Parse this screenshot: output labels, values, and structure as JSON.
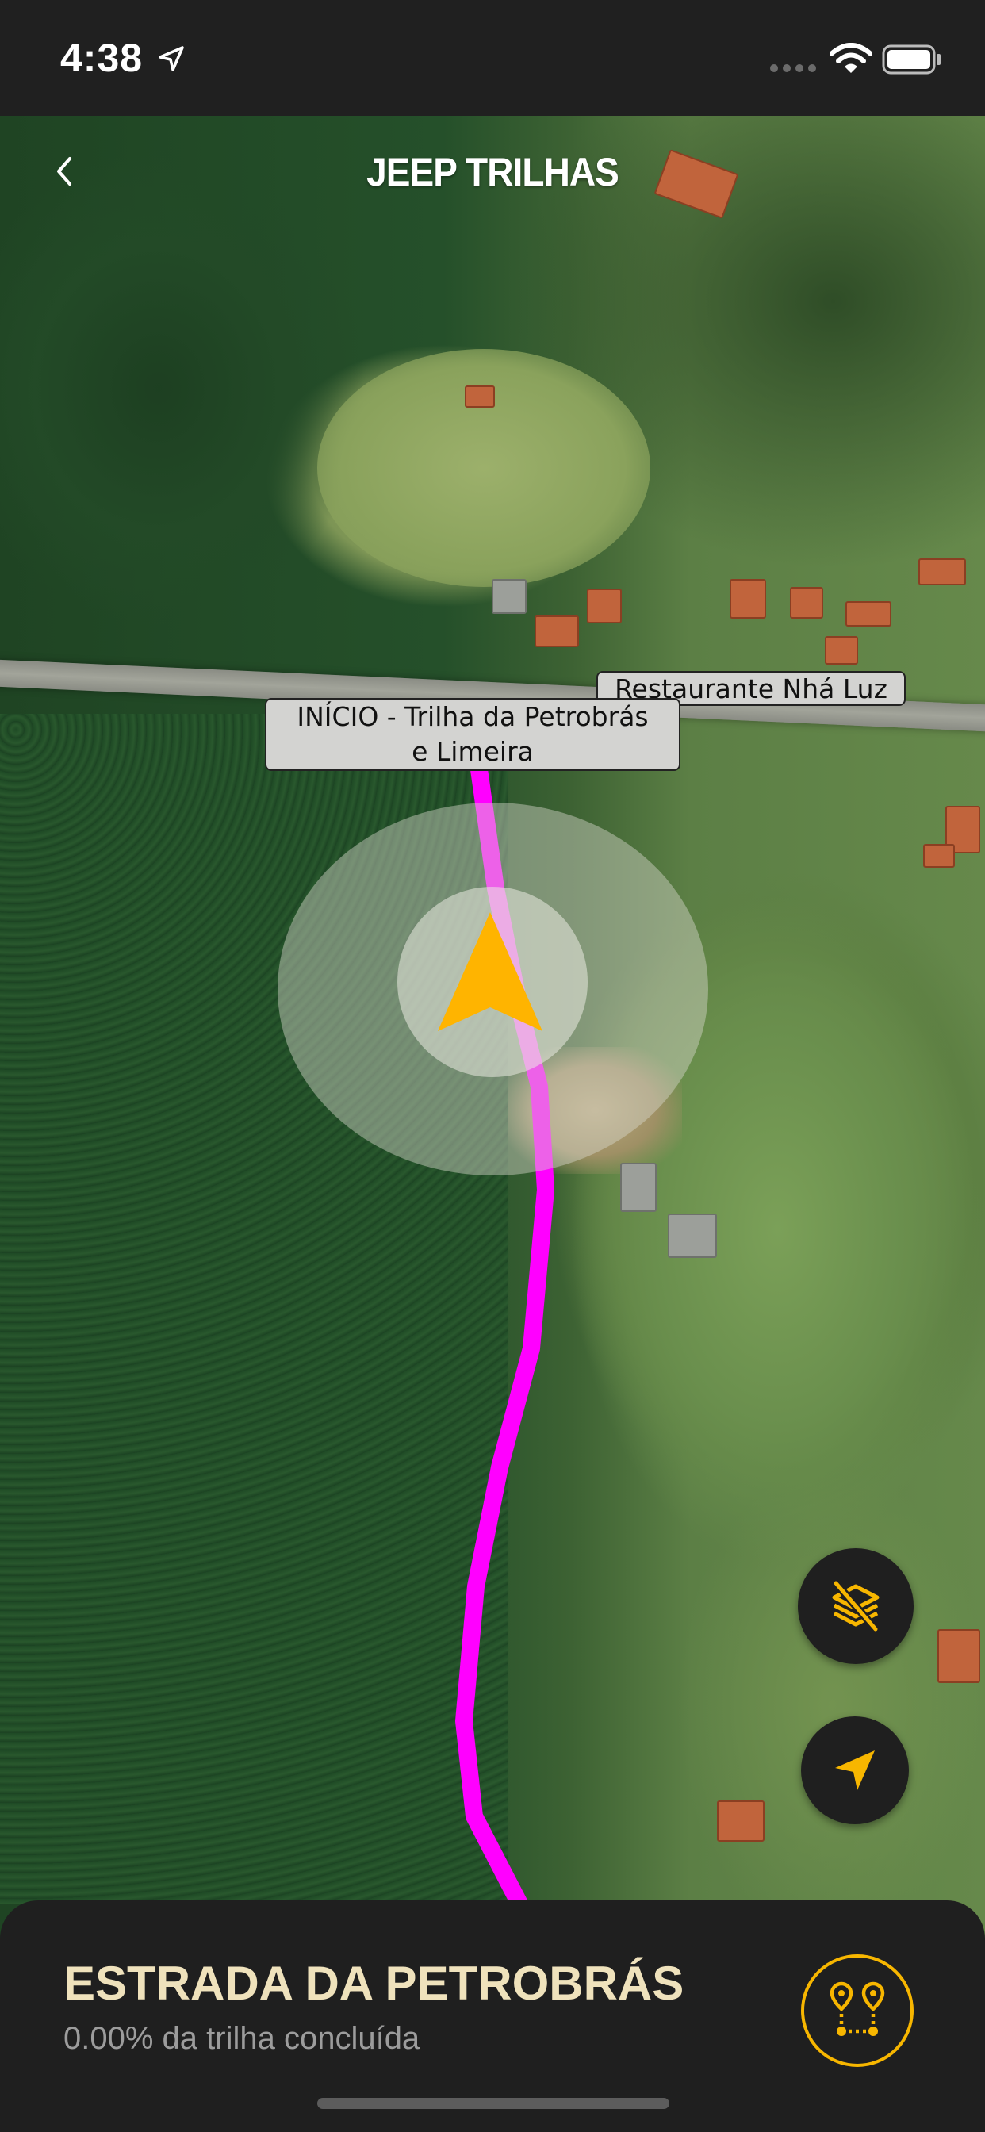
{
  "status_bar": {
    "time": "4:38"
  },
  "header": {
    "title": "JEEP TRILHAS",
    "back_icon": "chevron-left-icon"
  },
  "map": {
    "type": "satellite",
    "route_color": "#ff00ff",
    "labels": {
      "restaurant": "Restaurante Nhá Luz",
      "start_line1": "INÍCIO - Trilha da Petrobrás",
      "start_line2": "e Limeira"
    },
    "user_location_icon": "navigation-arrow-icon",
    "heading_color": "#ffb400"
  },
  "controls": {
    "layers_icon": "layers-off-icon",
    "locate_icon": "location-arrow-icon"
  },
  "bottom_sheet": {
    "trail_name": "ESTRADA DA PETROBRÁS",
    "progress_text": "0.00% da trilha concluída",
    "route_button_icon": "route-pins-icon"
  },
  "colors": {
    "accent": "#f7b600",
    "title_text": "#efe2bc",
    "sheet_bg": "#1f1f1f"
  }
}
